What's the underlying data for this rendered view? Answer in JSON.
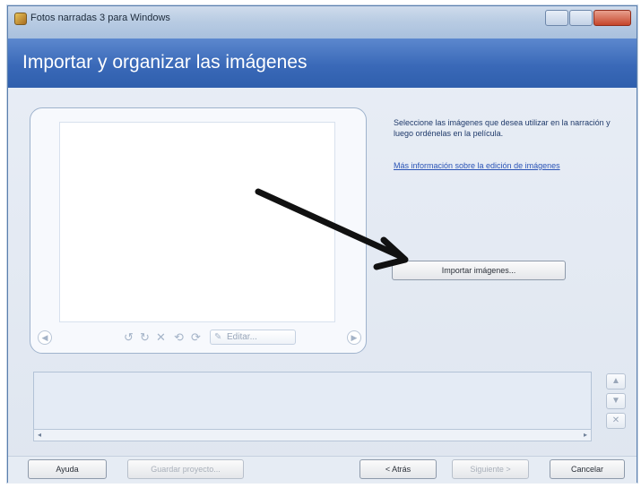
{
  "window": {
    "title": "Fotos narradas 3 para Windows"
  },
  "header": {
    "title": "Importar y organizar las imágenes"
  },
  "preview_panel": {
    "edit_label": "Editar..."
  },
  "instructions": {
    "text": "Seleccione las imágenes que desea utilizar en la narración y luego ordénelas en la película.",
    "link": "Más información sobre la edición de imágenes"
  },
  "import_button": {
    "label": "Importar imágenes..."
  },
  "footer": {
    "help": "Ayuda",
    "save": "Guardar proyecto...",
    "back": "< Atrás",
    "next": "Siguiente >",
    "cancel": "Cancelar"
  },
  "colors": {
    "header": "#3a69b8",
    "link": "#2b54b6",
    "arrow": "#111111"
  }
}
